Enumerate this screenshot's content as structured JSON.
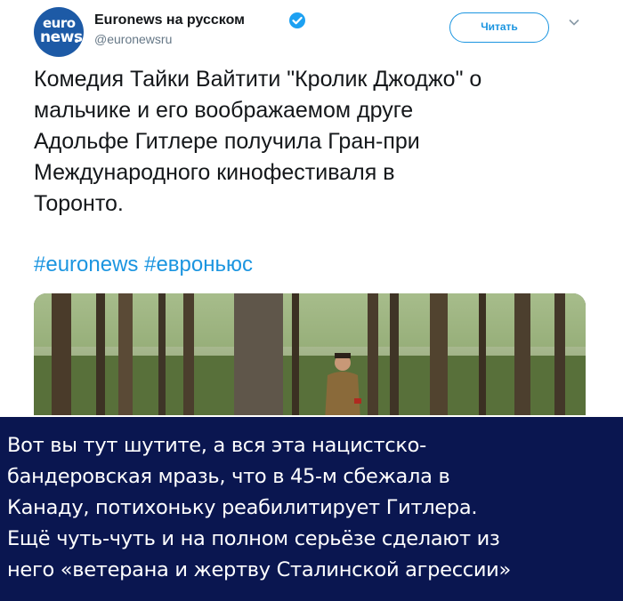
{
  "account": {
    "avatar_line1": "euro",
    "avatar_line2": "news",
    "name": "Euronews на русском",
    "handle": "@euronewsru"
  },
  "follow_label": "Читать",
  "tweet": {
    "lines": [
      "Комедия Тайки Вайтити \"Кролик Джоджо\" о",
      "мальчике и его воображаемом друге",
      "Адольфе Гитлере получила Гран-при",
      "Международного кинофестиваля в",
      "Торонто."
    ],
    "hashtags": [
      "#euronews",
      "#евроньюс"
    ]
  },
  "caption": {
    "lines": [
      "Вот вы тут шутите, а вся эта нацистско-",
      "бандеровская мразь, что в 45-м сбежала в",
      "Канаду, потихоньку реабилитирует Гитлера.",
      "Ещё чуть-чуть и на полном серьёзе сделают из",
      "него «ветерана и жертву Сталинской агрессии»"
    ]
  },
  "colors": {
    "link": "#1b95e0",
    "caption_bg": "#0a1650",
    "avatar_bg": "#1d5aa6"
  },
  "icons": {
    "verified": "verified-badge-icon",
    "chevron": "chevron-down-icon"
  }
}
